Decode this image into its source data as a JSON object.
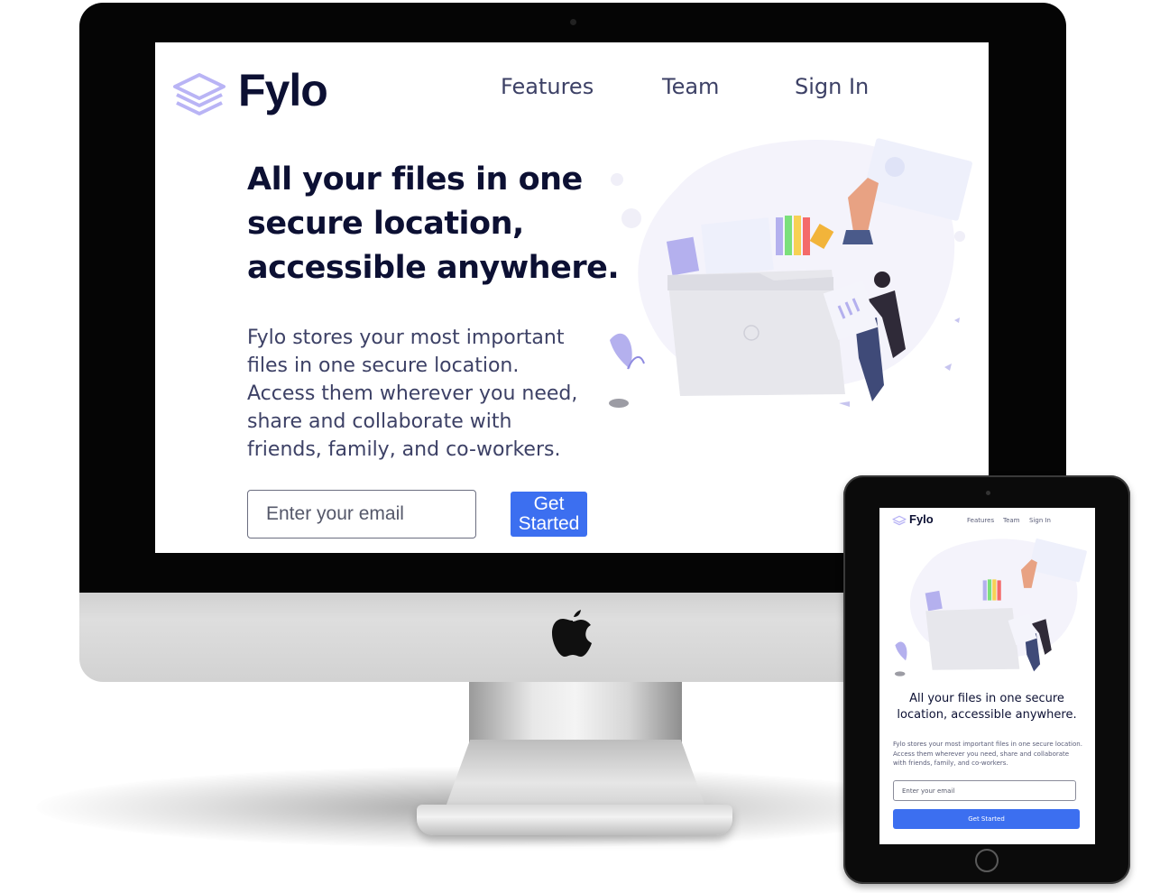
{
  "desktop": {
    "brand": "Fylo",
    "nav": [
      "Features",
      "Team",
      "Sign In"
    ],
    "hero_title": "All your files in one secure location, accessible anywhere.",
    "hero_body": "Fylo stores your most important files in one secure location. Access them wherever you need, share and collaborate with friends, family, and co-workers.",
    "email_placeholder": "Enter your email",
    "cta_label": "Get Started"
  },
  "tablet": {
    "brand": "Fylo",
    "nav": [
      "Features",
      "Team",
      "Sign In"
    ],
    "hero_title": "All your files in one secure location, accessible anywhere.",
    "hero_body": "Fylo stores your most important files in one secure location. Access them wherever you need, share and collaborate with friends, family, and co-workers.",
    "email_placeholder": "Enter your email",
    "cta_label": "Get Started"
  },
  "icons": {
    "logo": "stacked-layers-icon",
    "device_logo": "apple-logo-icon"
  },
  "colors": {
    "accent": "#3c6ff0",
    "dark_text": "#0c1033",
    "body_text": "#3d4166",
    "logo_purple": "#b9b4f5"
  }
}
